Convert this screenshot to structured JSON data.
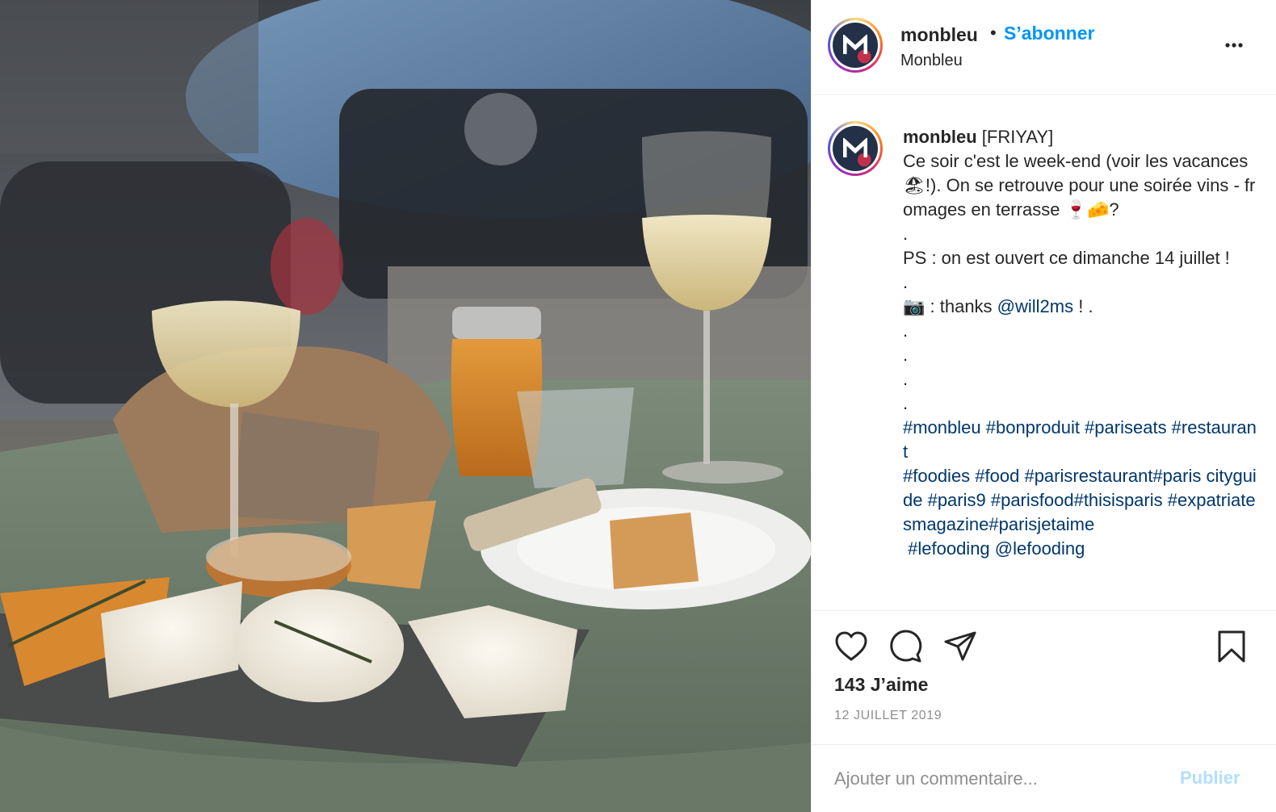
{
  "post": {
    "photo_description_icon": "photo",
    "account": {
      "username": "monbleu",
      "follow_label": "S’abonner",
      "location": "Monbleu",
      "dot": "•",
      "avatar_letter": "M"
    },
    "caption": {
      "username": "monbleu",
      "segments": [
        {
          "text": " [FRIYAY]\nCe soir c'est le week-end (voir les vacances 🏖!). On se retrouve pour une soirée vins - fromages en terrasse 🍷🧀?\n.\nPS : on est ouvert ce dimanche 14 juillet !\n.\n📷 : thanks ",
          "link": false
        },
        {
          "text": "@will2ms",
          "link": true
        },
        {
          "text": " ! .\n.\n.\n.\n.\n",
          "link": false
        },
        {
          "text": "#monbleu #bonproduit #pariseats #restaurant\n#foodies #food #parisrestaurant#paris cityguide #paris9 #parisfood#thisisparis #expatriatesmagazine#parisjetaime\n #lefooding @lefooding",
          "link": true
        }
      ]
    },
    "actions": {
      "like_icon": "heart-icon",
      "comment_icon": "comment-icon",
      "share_icon": "share-icon",
      "save_icon": "bookmark-icon"
    },
    "likes_label": "143 J’aime",
    "date": "12 JUILLET 2019",
    "comment": {
      "placeholder": "Ajouter un commentaire...",
      "publish_label": "Publier"
    }
  },
  "colors": {
    "link": "#00376b",
    "follow": "#0095f6",
    "publish_disabled": "#b2dffc",
    "muted": "#8e8e8e"
  }
}
